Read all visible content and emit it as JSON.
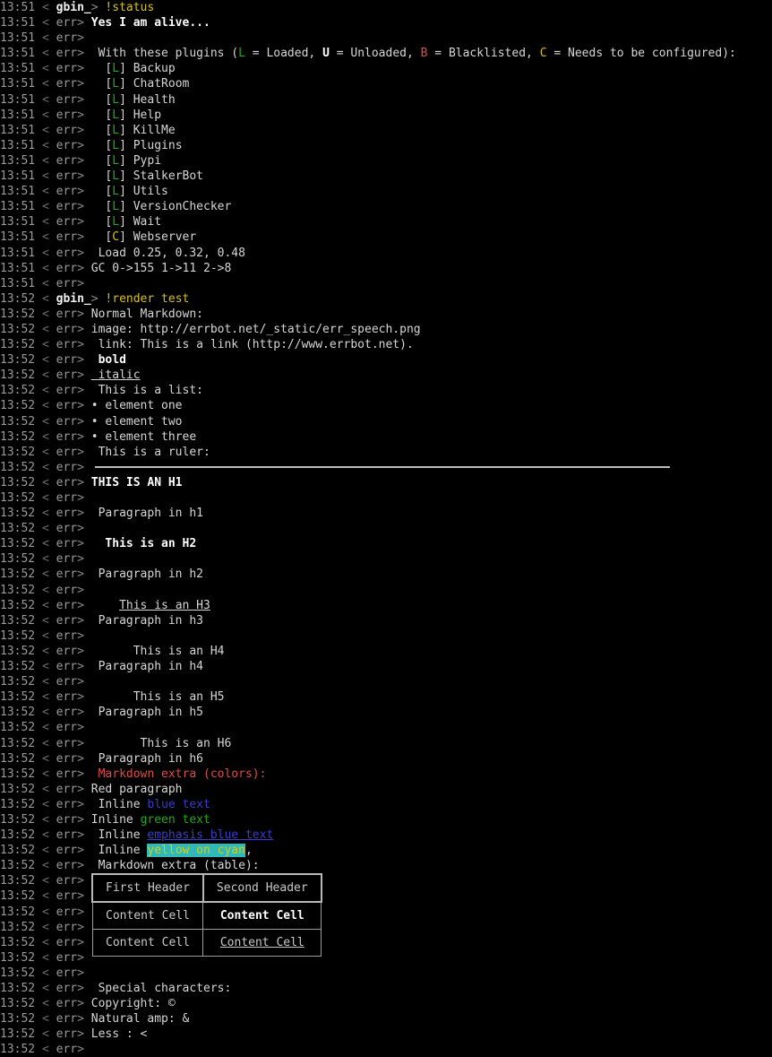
{
  "terminal": {
    "app": "irc-client-errbot-session",
    "background": "#000000",
    "foreground": "#d4d4d4",
    "colors": {
      "timestamp": "#9a9a9a",
      "nick_other": "#9a9a9a",
      "nick_self": "#f2f2f2",
      "green": "#1faa1f",
      "red": "#e04a4a",
      "yellow": "#d4c020",
      "blue": "#3b3bd0",
      "cyan_bg": "#2fb9b9",
      "yellow_on_cyan_fg": "#cfcf1e",
      "rule": "#bdbdbd",
      "table_header_border": "#b9b9b9",
      "table_cell_border": "#9c9c9c"
    },
    "nicks": {
      "self": "gbin_",
      "bot": "err"
    },
    "bracket_open": "<",
    "bracket_close": ">"
  },
  "lines": [
    {
      "ts": "13:51",
      "nick": "gbin_",
      "self": true,
      "text": "!status",
      "style": "cmd"
    },
    {
      "ts": "13:51",
      "nick": "err",
      "self": false,
      "text": "Yes I am alive...",
      "style": "boldw"
    },
    {
      "ts": "13:51",
      "nick": "err",
      "self": false,
      "text": ""
    },
    {
      "ts": "13:51",
      "nick": "err",
      "self": false,
      "text": " With these plugins (L = Loaded, U = Unloaded, B = Blacklisted, C = Needs to be configured):",
      "style": "legend"
    },
    {
      "ts": "13:51",
      "nick": "err",
      "self": false,
      "text": "  [L] Backup",
      "style": "plugin",
      "flag": "L",
      "plugin": "Backup"
    },
    {
      "ts": "13:51",
      "nick": "err",
      "self": false,
      "text": "  [L] ChatRoom",
      "style": "plugin",
      "flag": "L",
      "plugin": "ChatRoom"
    },
    {
      "ts": "13:51",
      "nick": "err",
      "self": false,
      "text": "  [L] Health",
      "style": "plugin",
      "flag": "L",
      "plugin": "Health"
    },
    {
      "ts": "13:51",
      "nick": "err",
      "self": false,
      "text": "  [L] Help",
      "style": "plugin",
      "flag": "L",
      "plugin": "Help"
    },
    {
      "ts": "13:51",
      "nick": "err",
      "self": false,
      "text": "  [L] KillMe",
      "style": "plugin",
      "flag": "L",
      "plugin": "KillMe"
    },
    {
      "ts": "13:51",
      "nick": "err",
      "self": false,
      "text": "  [L] Plugins",
      "style": "plugin",
      "flag": "L",
      "plugin": "Plugins"
    },
    {
      "ts": "13:51",
      "nick": "err",
      "self": false,
      "text": "  [L] Pypi",
      "style": "plugin",
      "flag": "L",
      "plugin": "Pypi"
    },
    {
      "ts": "13:51",
      "nick": "err",
      "self": false,
      "text": "  [L] StalkerBot",
      "style": "plugin",
      "flag": "L",
      "plugin": "StalkerBot"
    },
    {
      "ts": "13:51",
      "nick": "err",
      "self": false,
      "text": "  [L] Utils",
      "style": "plugin",
      "flag": "L",
      "plugin": "Utils"
    },
    {
      "ts": "13:51",
      "nick": "err",
      "self": false,
      "text": "  [L] VersionChecker",
      "style": "plugin",
      "flag": "L",
      "plugin": "VersionChecker"
    },
    {
      "ts": "13:51",
      "nick": "err",
      "self": false,
      "text": "  [L] Wait",
      "style": "plugin",
      "flag": "L",
      "plugin": "Wait"
    },
    {
      "ts": "13:51",
      "nick": "err",
      "self": false,
      "text": "  [C] Webserver",
      "style": "plugin",
      "flag": "C",
      "plugin": "Webserver"
    },
    {
      "ts": "13:51",
      "nick": "err",
      "self": false,
      "text": " Load 0.25, 0.32, 0.48"
    },
    {
      "ts": "13:51",
      "nick": "err",
      "self": false,
      "text": "GC 0->155 1->11 2->8"
    },
    {
      "ts": "13:51",
      "nick": "err",
      "self": false,
      "text": ""
    },
    {
      "ts": "13:52",
      "nick": "gbin_",
      "self": true,
      "text": "!render test",
      "style": "cmd"
    },
    {
      "ts": "13:52",
      "nick": "err",
      "self": false,
      "text": "Normal Markdown:"
    },
    {
      "ts": "13:52",
      "nick": "err",
      "self": false,
      "text": "image: http://errbot.net/_static/err_speech.png"
    },
    {
      "ts": "13:52",
      "nick": "err",
      "self": false,
      "text": " link: This is a link (http://www.errbot.net)."
    },
    {
      "ts": "13:52",
      "nick": "err",
      "self": false,
      "text": " bold",
      "style": "bold"
    },
    {
      "ts": "13:52",
      "nick": "err",
      "self": false,
      "text": " italic",
      "style": "italic"
    },
    {
      "ts": "13:52",
      "nick": "err",
      "self": false,
      "text": " This is a list:"
    },
    {
      "ts": "13:52",
      "nick": "err",
      "self": false,
      "text": "• element one"
    },
    {
      "ts": "13:52",
      "nick": "err",
      "self": false,
      "text": "• element two"
    },
    {
      "ts": "13:52",
      "nick": "err",
      "self": false,
      "text": "• element three"
    },
    {
      "ts": "13:52",
      "nick": "err",
      "self": false,
      "text": " This is a ruler:"
    },
    {
      "ts": "13:52",
      "nick": "err",
      "self": false,
      "text": "",
      "style": "ruler"
    },
    {
      "ts": "13:52",
      "nick": "err",
      "self": false,
      "text": "THIS IS AN H1",
      "style": "h1"
    },
    {
      "ts": "13:52",
      "nick": "err",
      "self": false,
      "text": ""
    },
    {
      "ts": "13:52",
      "nick": "err",
      "self": false,
      "text": " Paragraph in h1"
    },
    {
      "ts": "13:52",
      "nick": "err",
      "self": false,
      "text": ""
    },
    {
      "ts": "13:52",
      "nick": "err",
      "self": false,
      "text": "  This is an H2",
      "style": "h2"
    },
    {
      "ts": "13:52",
      "nick": "err",
      "self": false,
      "text": ""
    },
    {
      "ts": "13:52",
      "nick": "err",
      "self": false,
      "text": " Paragraph in h2"
    },
    {
      "ts": "13:52",
      "nick": "err",
      "self": false,
      "text": ""
    },
    {
      "ts": "13:52",
      "nick": "err",
      "self": false,
      "text": "    This is an H3",
      "style": "h3"
    },
    {
      "ts": "13:52",
      "nick": "err",
      "self": false,
      "text": " Paragraph in h3"
    },
    {
      "ts": "13:52",
      "nick": "err",
      "self": false,
      "text": ""
    },
    {
      "ts": "13:52",
      "nick": "err",
      "self": false,
      "text": "      This is an H4",
      "style": "h4"
    },
    {
      "ts": "13:52",
      "nick": "err",
      "self": false,
      "text": " Paragraph in h4"
    },
    {
      "ts": "13:52",
      "nick": "err",
      "self": false,
      "text": ""
    },
    {
      "ts": "13:52",
      "nick": "err",
      "self": false,
      "text": "      This is an H5",
      "style": "h5"
    },
    {
      "ts": "13:52",
      "nick": "err",
      "self": false,
      "text": " Paragraph in h5"
    },
    {
      "ts": "13:52",
      "nick": "err",
      "self": false,
      "text": ""
    },
    {
      "ts": "13:52",
      "nick": "err",
      "self": false,
      "text": "       This is an H6",
      "style": "h6"
    },
    {
      "ts": "13:52",
      "nick": "err",
      "self": false,
      "text": " Paragraph in h6"
    },
    {
      "ts": "13:52",
      "nick": "err",
      "self": false,
      "text": " Markdown extra (colors):",
      "style": "red"
    },
    {
      "ts": "13:52",
      "nick": "err",
      "self": false,
      "text": "Red paragraph"
    },
    {
      "ts": "13:52",
      "nick": "err",
      "self": false,
      "text": " Inline blue text",
      "style": "inline-blue"
    },
    {
      "ts": "13:52",
      "nick": "err",
      "self": false,
      "text": "Inline green text",
      "style": "inline-green"
    },
    {
      "ts": "13:52",
      "nick": "err",
      "self": false,
      "text": " Inline emphasis blue text",
      "style": "inline-blue-em"
    },
    {
      "ts": "13:52",
      "nick": "err",
      "self": false,
      "text": " Inline yellow on cyan,",
      "style": "inline-yellow-cyan"
    },
    {
      "ts": "13:52",
      "nick": "err",
      "self": false,
      "text": " Markdown extra (table):"
    },
    {
      "ts": "13:52",
      "nick": "err",
      "self": false,
      "text": ""
    },
    {
      "ts": "13:52",
      "nick": "err",
      "self": false,
      "text": ""
    },
    {
      "ts": "13:52",
      "nick": "err",
      "self": false,
      "text": ""
    },
    {
      "ts": "13:52",
      "nick": "err",
      "self": false,
      "text": ""
    },
    {
      "ts": "13:52",
      "nick": "err",
      "self": false,
      "text": ""
    },
    {
      "ts": "13:52",
      "nick": "err",
      "self": false,
      "text": ""
    },
    {
      "ts": "13:52",
      "nick": "err",
      "self": false,
      "text": ""
    },
    {
      "ts": "13:52",
      "nick": "err",
      "self": false,
      "text": " Special characters:"
    },
    {
      "ts": "13:52",
      "nick": "err",
      "self": false,
      "text": "Copyright: ©"
    },
    {
      "ts": "13:52",
      "nick": "err",
      "self": false,
      "text": "Natural amp: &"
    },
    {
      "ts": "13:52",
      "nick": "err",
      "self": false,
      "text": "Less : <"
    },
    {
      "ts": "13:52",
      "nick": "err",
      "self": false,
      "text": ""
    }
  ],
  "segments": {
    "legend": {
      "prefix": " With these plugins (",
      "l_key": "L",
      "l_text": " = Loaded, ",
      "u_key": "U",
      "u_text": " = Unloaded, ",
      "b_key": "B",
      "b_text": " = Blacklisted, ",
      "c_key": "C",
      "c_text": " = Needs to be configured):"
    },
    "inline_blue": {
      "lead": " Inline ",
      "colored": "blue text"
    },
    "inline_green": {
      "lead": "Inline ",
      "colored": "green text"
    },
    "inline_blue_em": {
      "lead": " Inline ",
      "colored": "emphasis blue text"
    },
    "inline_yellow_cyan": {
      "lead": " Inline ",
      "colored": "yellow on cyan",
      "trail": ","
    }
  },
  "table": {
    "headers": [
      "First Header",
      "Second Header"
    ],
    "rows": [
      [
        {
          "text": "Content Cell",
          "style": "plain"
        },
        {
          "text": "Content Cell",
          "style": "bold"
        }
      ],
      [
        {
          "text": "Content Cell",
          "style": "plain"
        },
        {
          "text": "Content Cell",
          "style": "under"
        }
      ]
    ]
  }
}
